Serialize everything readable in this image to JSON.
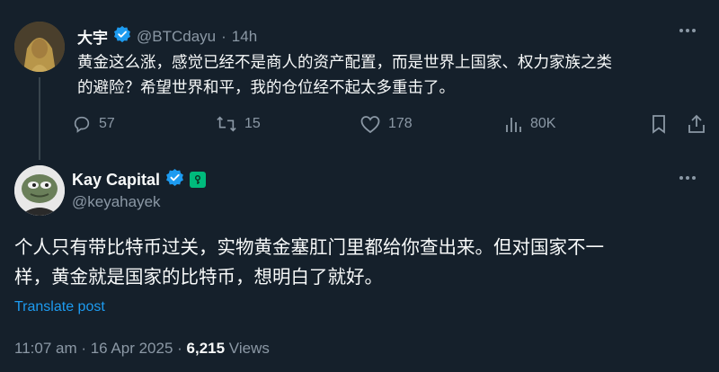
{
  "reply": {
    "display_name": "大宇",
    "handle": "@BTCdayu",
    "separator": "·",
    "time": "14h",
    "text_line1": "黄金这么涨，感觉已经不是商人的资产配置，而是世界上国家、权力家族之类",
    "text_line2": "的避险？希望世界和平，我的仓位经不起太多重击了。",
    "stats": {
      "replies": "57",
      "reposts": "15",
      "likes": "178",
      "views": "80K"
    },
    "icons": [
      "reply-icon",
      "repost-icon",
      "like-icon",
      "views-icon",
      "bookmark-icon",
      "share-icon"
    ]
  },
  "main": {
    "display_name": "Kay Capital",
    "handle": "@keyahayek",
    "text_line1": "个人只有带比特币过关，实物黄金塞肛门里都给你查出来。但对国家不一",
    "text_line2": "样，黄金就是国家的比特币，想明白了就好。",
    "translate_label": "Translate post",
    "timestamp": "11:07 am · 16 Apr 2025 · ",
    "views_count": "6,215",
    "views_label": " Views"
  },
  "colors": {
    "background": "#15202b",
    "text": "#f7f9f9",
    "muted": "#8b98a5",
    "verified": "#1d9bf0",
    "link": "#1d9bf0",
    "affiliate_badge": "#00ba7c"
  }
}
